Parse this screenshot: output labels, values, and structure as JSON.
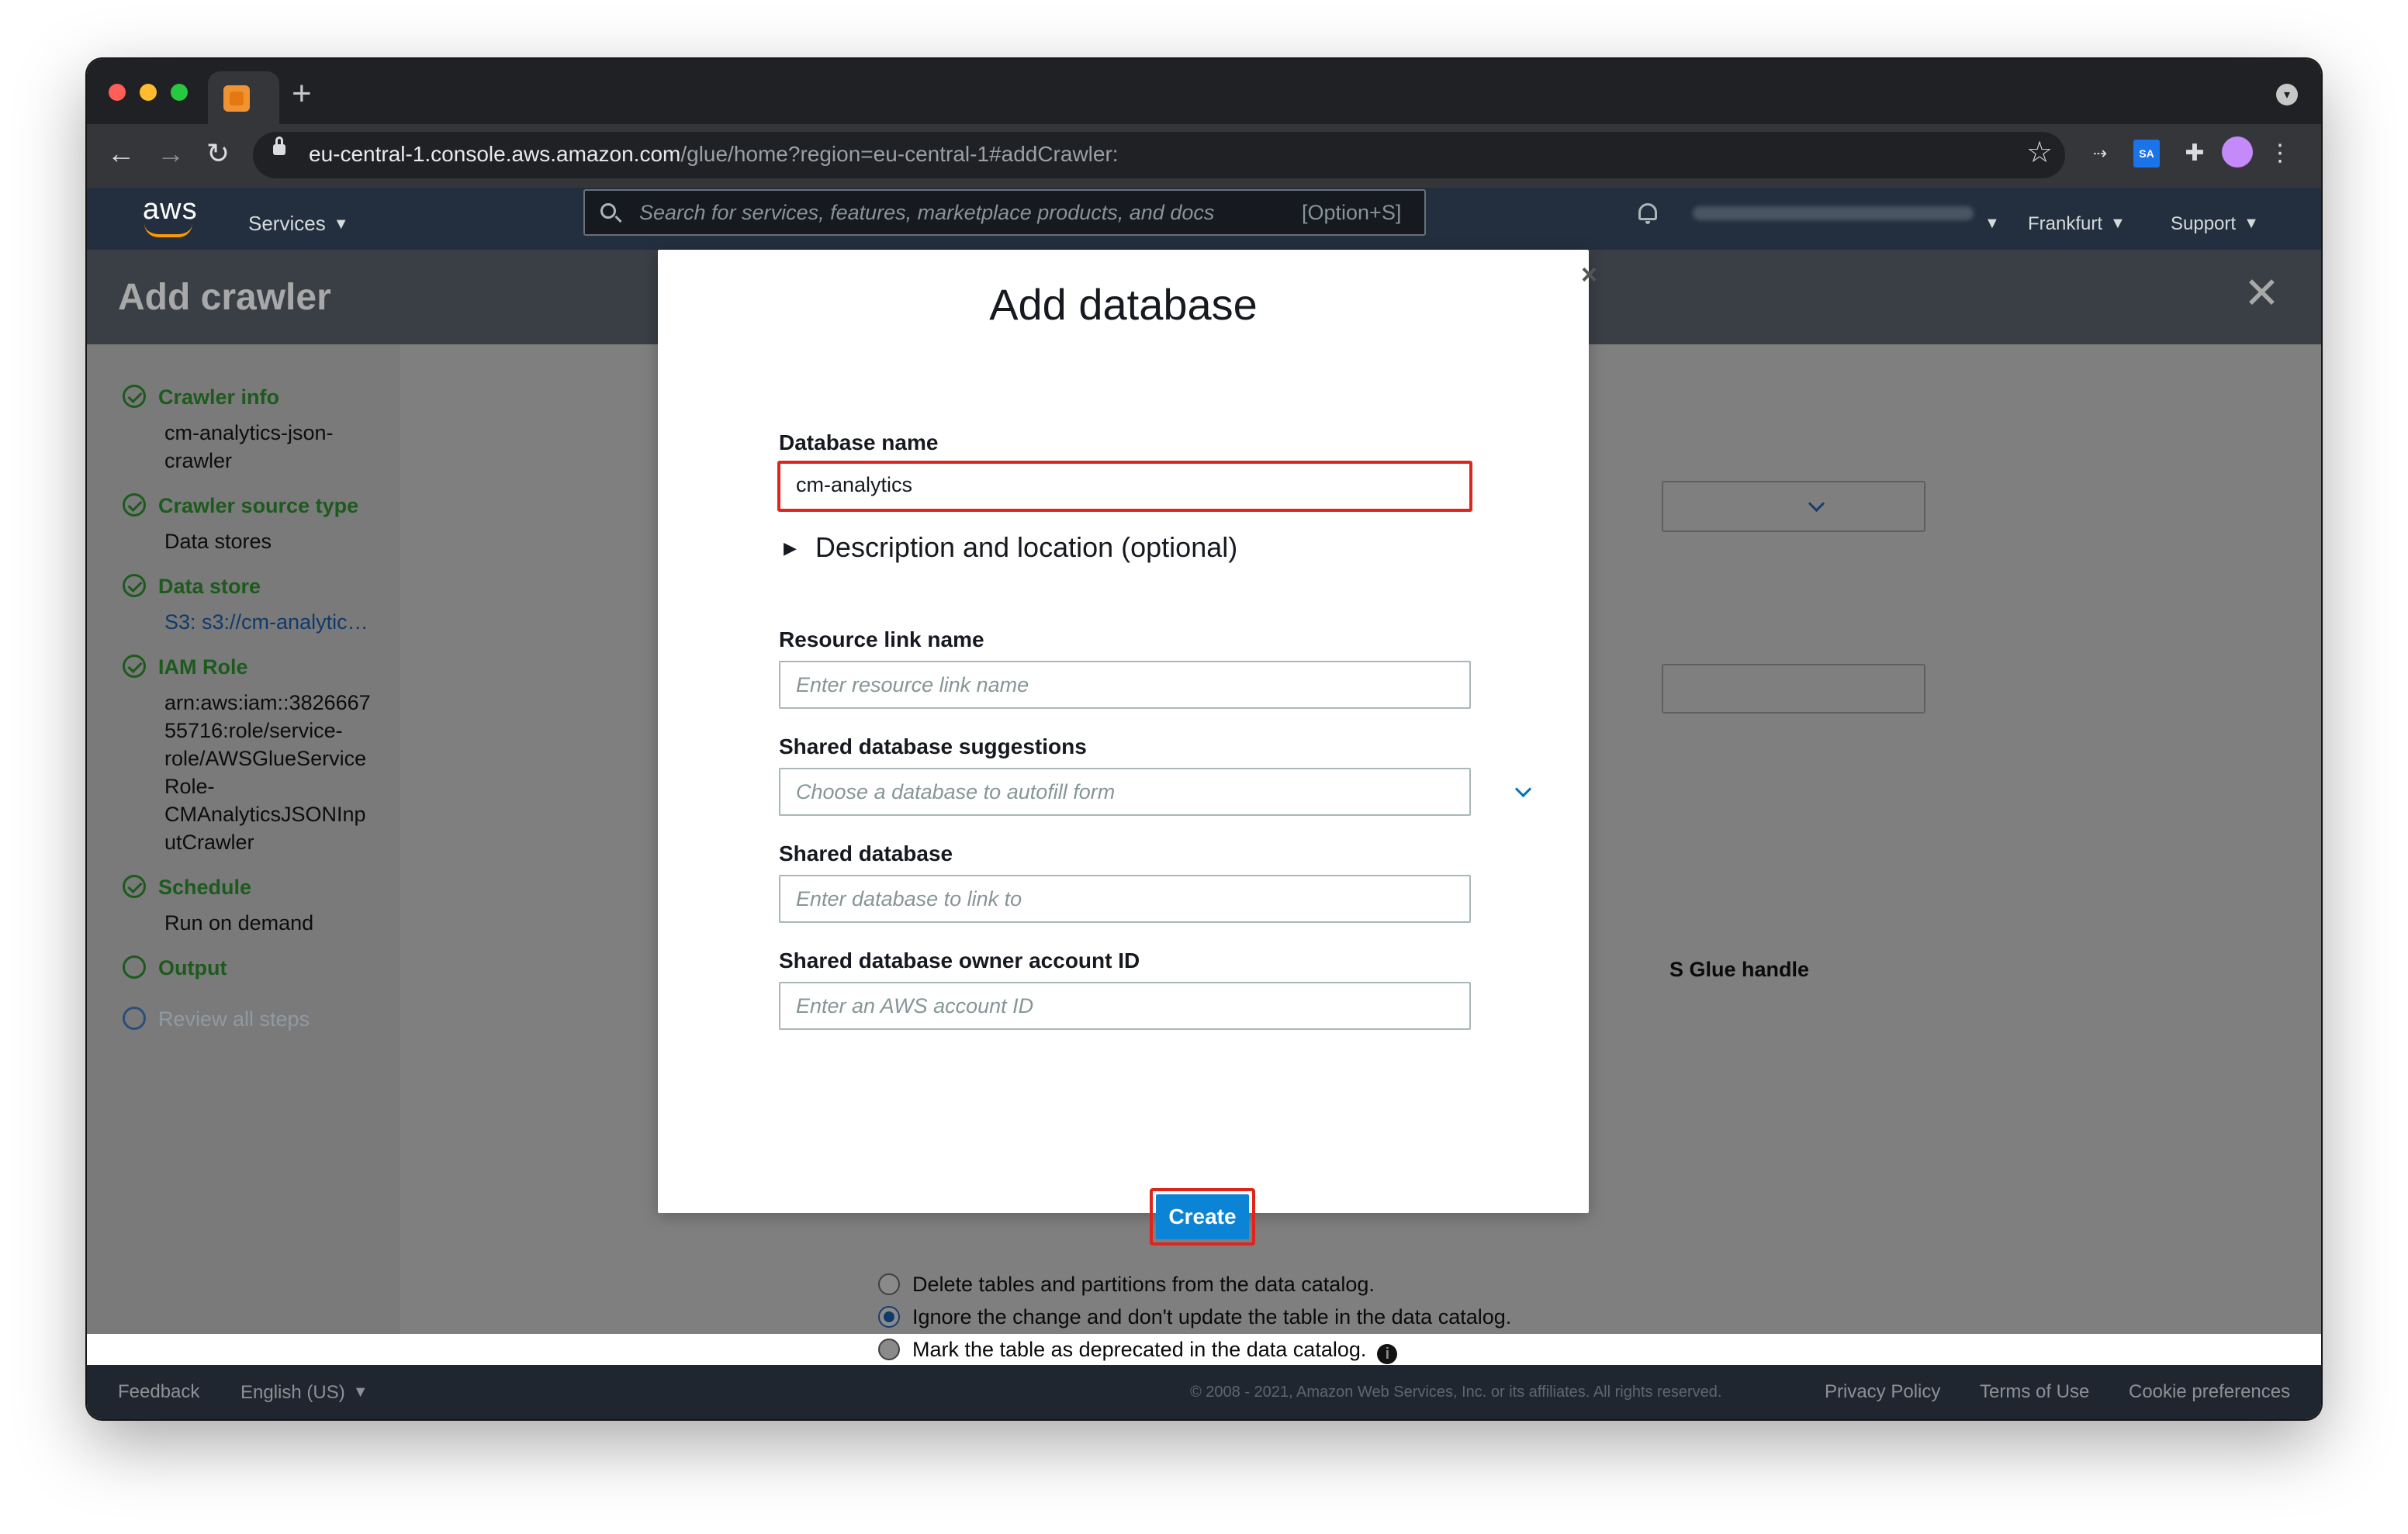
{
  "browser": {
    "url_host": "eu-central-1.console.aws.amazon.com",
    "url_path": "/glue/home?region=eu-central-1#addCrawler:",
    "new_tab_label": "+",
    "extensions": [
      "ext-icon-1",
      "saml-icon",
      "puzzle-icon",
      "profile-avatar"
    ]
  },
  "aws_nav": {
    "logo": "aws",
    "services": "Services",
    "search_placeholder": "Search for services, features, marketplace products, and docs",
    "search_shortcut": "[Option+S]",
    "region": "Frankfurt",
    "support": "Support"
  },
  "page": {
    "title": "Add crawler",
    "steps": [
      {
        "label": "Crawler info",
        "value": "cm-analytics-json-crawler",
        "status": "done"
      },
      {
        "label": "Crawler source type",
        "value": "Data stores",
        "status": "done"
      },
      {
        "label": "Data store",
        "value": "S3: s3://cm-analytic…",
        "status": "done"
      },
      {
        "label": "IAM Role",
        "value": "arn:aws:iam::382666755716:role/service-role/AWSGlueServiceRole-CMAnalyticsJSONInputCrawler",
        "status": "done"
      },
      {
        "label": "Schedule",
        "value": "Run on demand",
        "status": "done"
      },
      {
        "label": "Output",
        "value": "",
        "status": "current"
      },
      {
        "label": "Review all steps",
        "value": "",
        "status": "pending"
      }
    ],
    "behind_text": "S Glue handle",
    "options": [
      {
        "label": "Delete tables and partitions from the data catalog.",
        "selected": false
      },
      {
        "label": "Ignore the change and don't update the table in the data catalog.",
        "selected": true
      },
      {
        "label": "Mark the table as deprecated in the data catalog.",
        "selected": false
      }
    ]
  },
  "modal": {
    "title": "Add database",
    "close": "×",
    "database_name_label": "Database name",
    "database_name_value": "cm-analytics",
    "description_toggle": "Description and location (optional)",
    "resource_link_label": "Resource link name",
    "resource_link_placeholder": "Enter resource link name",
    "shared_suggestions_label": "Shared database suggestions",
    "shared_suggestions_placeholder": "Choose a database to autofill form",
    "shared_database_label": "Shared database",
    "shared_database_placeholder": "Enter database to link to",
    "owner_label": "Shared database owner account ID",
    "owner_placeholder": "Enter an AWS account ID",
    "create_label": "Create"
  },
  "footer": {
    "feedback": "Feedback",
    "language": "English (US)",
    "copyright": "© 2008 - 2021, Amazon Web Services, Inc. or its affiliates. All rights reserved.",
    "privacy": "Privacy Policy",
    "terms": "Terms of Use",
    "cookies": "Cookie preferences"
  },
  "colors": {
    "aws_nav": "#232f3e",
    "accent_orange": "#ff9900",
    "primary_button": "#0b84d5",
    "highlight_red": "#e0241c",
    "step_green": "#1d5a1d"
  }
}
